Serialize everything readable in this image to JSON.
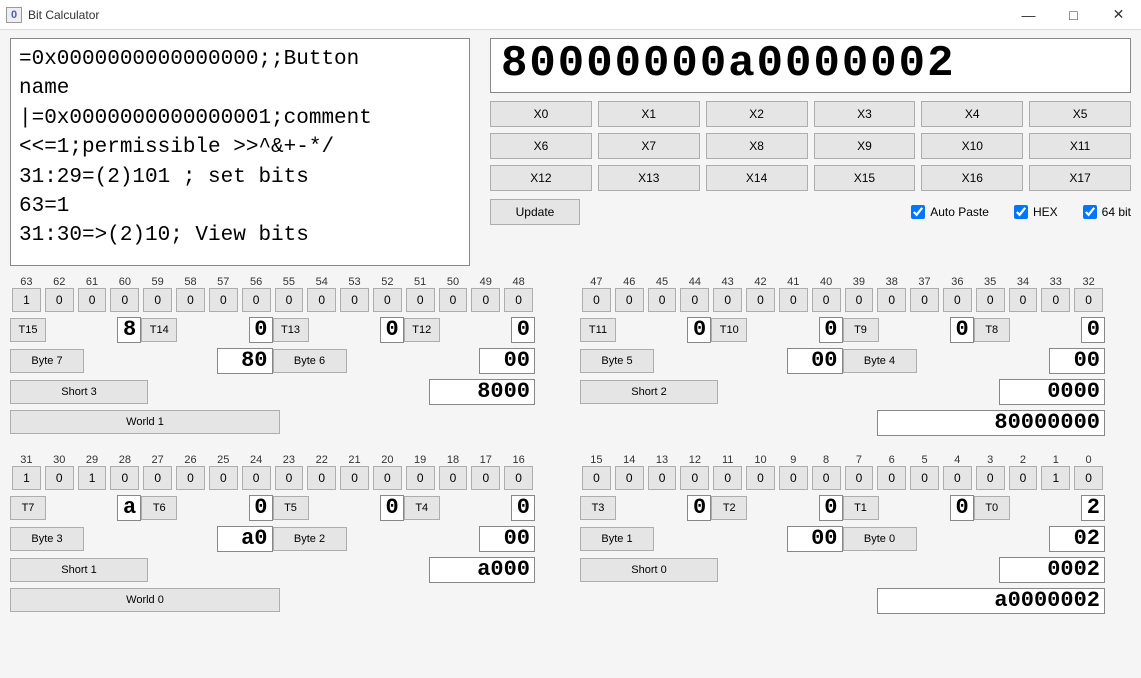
{
  "window": {
    "title": "Bit Calculator"
  },
  "script_text": "=0x0000000000000000;;Button\nname\n|=0x0000000000000001;comment\n<<=1;permissible >>^&+-*/\n31:29=(2)101 ; set bits\n63=1\n31:30=>(2)10; View bits",
  "big_value": "80000000a0000002",
  "xbuttons": [
    "X0",
    "X1",
    "X2",
    "X3",
    "X4",
    "X5",
    "X6",
    "X7",
    "X8",
    "X9",
    "X10",
    "X11",
    "X12",
    "X13",
    "X14",
    "X15",
    "X16",
    "X17"
  ],
  "update_label": "Update",
  "checks": {
    "auto_paste": "Auto Paste",
    "hex": "HEX",
    "bit64": "64 bit"
  },
  "upper": {
    "left": {
      "bit_nums": [
        "63",
        "62",
        "61",
        "60",
        "59",
        "58",
        "57",
        "56",
        "55",
        "54",
        "53",
        "52",
        "51",
        "50",
        "49",
        "48"
      ],
      "bits": [
        "1",
        "0",
        "0",
        "0",
        "0",
        "0",
        "0",
        "0",
        "0",
        "0",
        "0",
        "0",
        "0",
        "0",
        "0",
        "0"
      ],
      "nibs": [
        {
          "t": "T15",
          "v": "8"
        },
        {
          "t": "T14",
          "v": "0"
        },
        {
          "t": "T13",
          "v": "0"
        },
        {
          "t": "T12",
          "v": "0"
        }
      ],
      "bytes": [
        {
          "t": "Byte 7",
          "v": "80"
        },
        {
          "t": "Byte 6",
          "v": "00"
        }
      ],
      "short": {
        "t": "Short 3",
        "v": "8000"
      },
      "world": {
        "t": "World 1",
        "v": "80000000"
      }
    },
    "right": {
      "bit_nums": [
        "47",
        "46",
        "45",
        "44",
        "43",
        "42",
        "41",
        "40",
        "39",
        "38",
        "37",
        "36",
        "35",
        "34",
        "33",
        "32"
      ],
      "bits": [
        "0",
        "0",
        "0",
        "0",
        "0",
        "0",
        "0",
        "0",
        "0",
        "0",
        "0",
        "0",
        "0",
        "0",
        "0",
        "0"
      ],
      "nibs": [
        {
          "t": "T11",
          "v": "0"
        },
        {
          "t": "T10",
          "v": "0"
        },
        {
          "t": "T9",
          "v": "0"
        },
        {
          "t": "T8",
          "v": "0"
        }
      ],
      "bytes": [
        {
          "t": "Byte 5",
          "v": "00"
        },
        {
          "t": "Byte 4",
          "v": "00"
        }
      ],
      "short": {
        "t": "Short 2",
        "v": "0000"
      }
    }
  },
  "lower": {
    "left": {
      "bit_nums": [
        "31",
        "30",
        "29",
        "28",
        "27",
        "26",
        "25",
        "24",
        "23",
        "22",
        "21",
        "20",
        "19",
        "18",
        "17",
        "16"
      ],
      "bits": [
        "1",
        "0",
        "1",
        "0",
        "0",
        "0",
        "0",
        "0",
        "0",
        "0",
        "0",
        "0",
        "0",
        "0",
        "0",
        "0"
      ],
      "nibs": [
        {
          "t": "T7",
          "v": "a"
        },
        {
          "t": "T6",
          "v": "0"
        },
        {
          "t": "T5",
          "v": "0"
        },
        {
          "t": "T4",
          "v": "0"
        }
      ],
      "bytes": [
        {
          "t": "Byte 3",
          "v": "a0"
        },
        {
          "t": "Byte 2",
          "v": "00"
        }
      ],
      "short": {
        "t": "Short 1",
        "v": "a000"
      },
      "world": {
        "t": "World 0",
        "v": "a0000002"
      }
    },
    "right": {
      "bit_nums": [
        "15",
        "14",
        "13",
        "12",
        "11",
        "10",
        "9",
        "8",
        "7",
        "6",
        "5",
        "4",
        "3",
        "2",
        "1",
        "0"
      ],
      "bits": [
        "0",
        "0",
        "0",
        "0",
        "0",
        "0",
        "0",
        "0",
        "0",
        "0",
        "0",
        "0",
        "0",
        "0",
        "1",
        "0"
      ],
      "nibs": [
        {
          "t": "T3",
          "v": "0"
        },
        {
          "t": "T2",
          "v": "0"
        },
        {
          "t": "T1",
          "v": "0"
        },
        {
          "t": "T0",
          "v": "2"
        }
      ],
      "bytes": [
        {
          "t": "Byte 1",
          "v": "00"
        },
        {
          "t": "Byte 0",
          "v": "02"
        }
      ],
      "short": {
        "t": "Short 0",
        "v": "0002"
      }
    }
  }
}
